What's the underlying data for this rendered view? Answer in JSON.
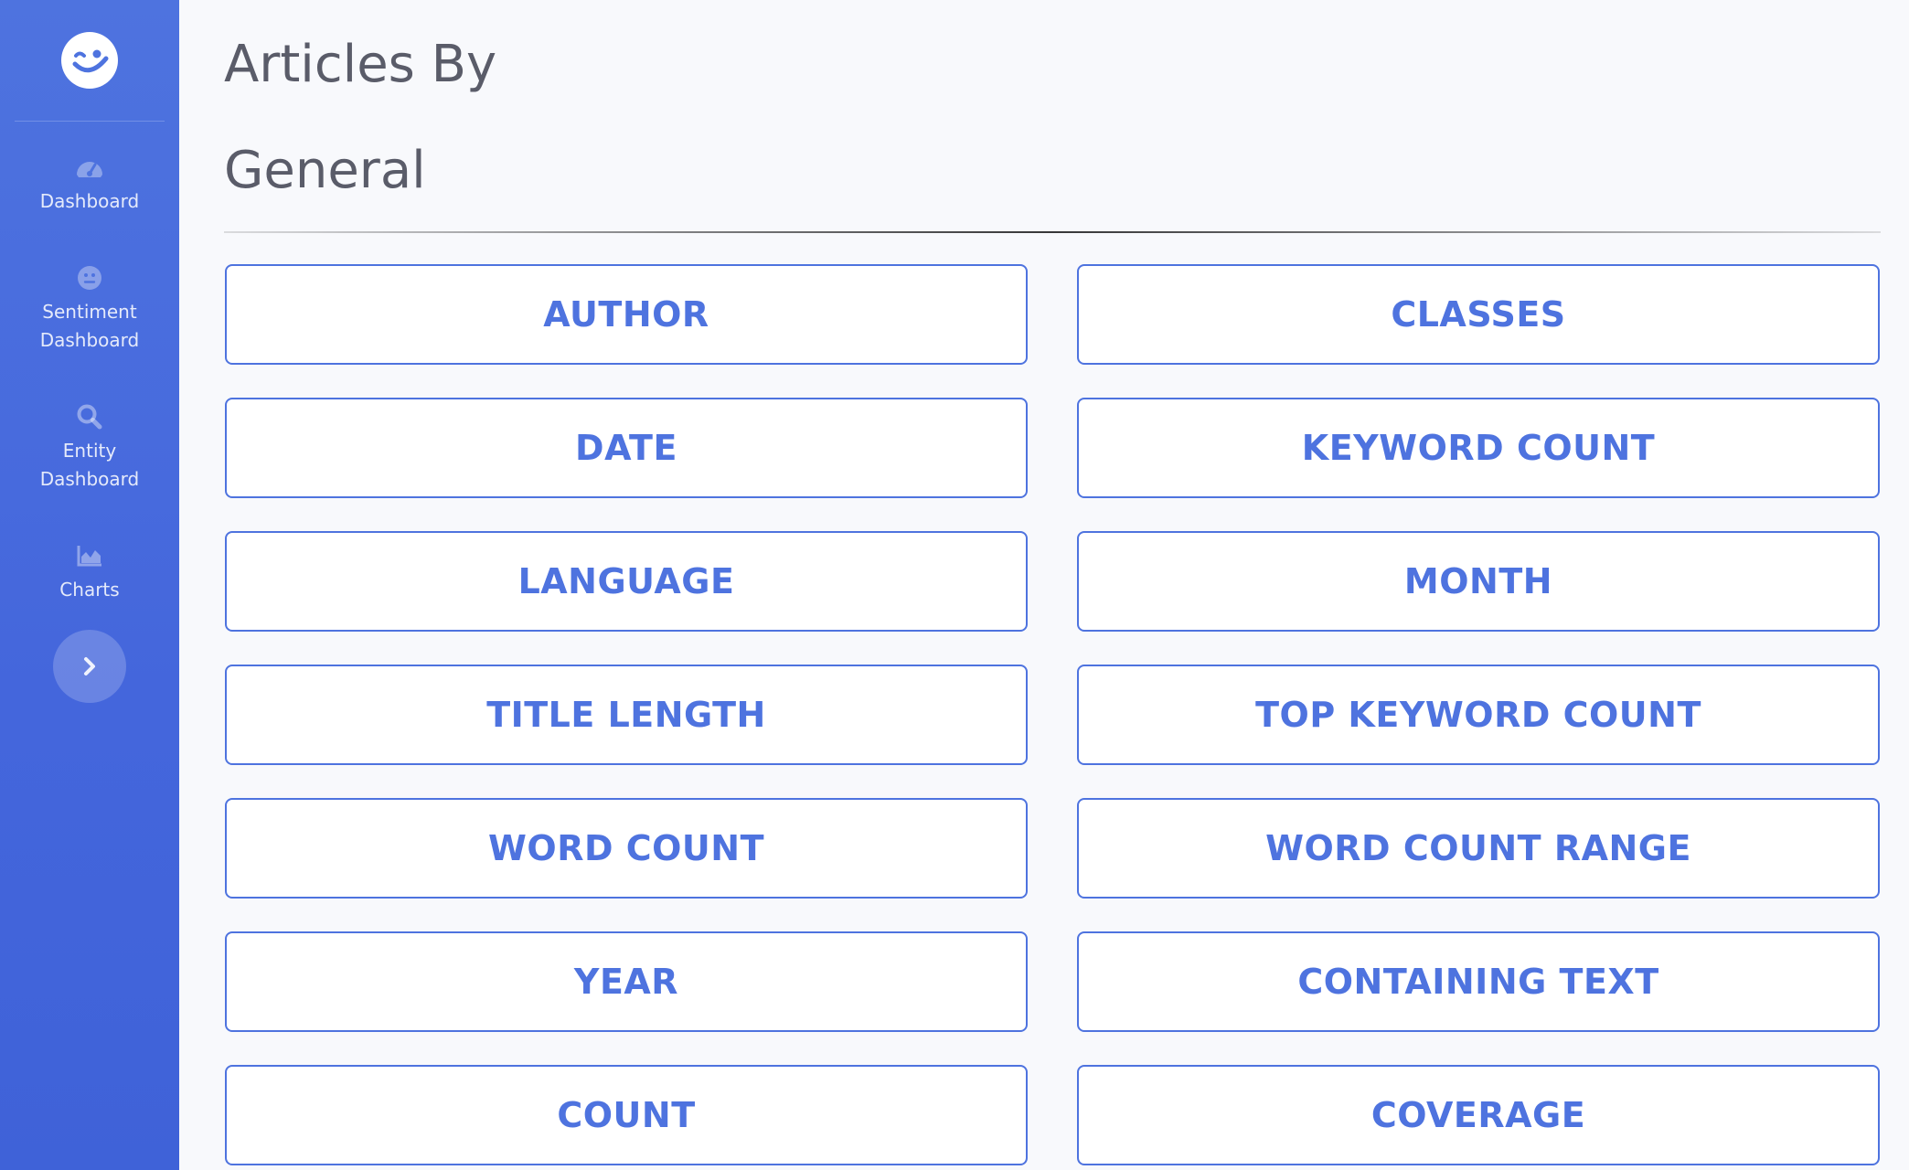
{
  "sidebar": {
    "brand_icon": "winking-smiley-icon",
    "items": [
      {
        "label": "Dashboard",
        "icon": "tachometer-icon"
      },
      {
        "label": "Sentiment Dashboard",
        "icon": "neutral-face-icon"
      },
      {
        "label": "Entity Dashboard",
        "icon": "search-icon"
      },
      {
        "label": "Charts",
        "icon": "area-chart-icon"
      }
    ],
    "toggle_icon": "chevron-right-icon"
  },
  "main": {
    "title": "Articles By",
    "section_title": "General",
    "buttons": [
      "AUTHOR",
      "CLASSES",
      "DATE",
      "KEYWORD COUNT",
      "LANGUAGE",
      "MONTH",
      "TITLE LENGTH",
      "TOP KEYWORD COUNT",
      "WORD COUNT",
      "WORD COUNT RANGE",
      "YEAR",
      "CONTAINING TEXT",
      "COUNT",
      "COVERAGE"
    ]
  },
  "colors": {
    "primary": "#4e73df",
    "background": "#f8f9fc",
    "heading": "#5a5c69"
  }
}
